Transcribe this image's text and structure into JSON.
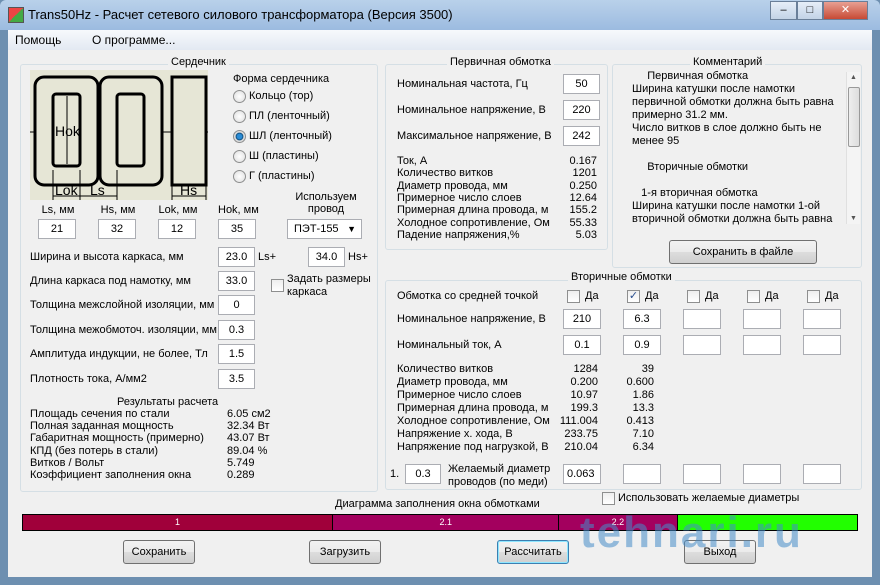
{
  "window": {
    "title": "Trans50Hz - Расчет сетевого силового трансформатора (Версия 3500)",
    "minimize": "–",
    "maximize": "□",
    "close": "✕"
  },
  "menu": [
    "Помощь",
    "О программе..."
  ],
  "core": {
    "title": "Сердечник",
    "diagram_labels": {
      "hok": "Hok",
      "lok": "Lok",
      "ls": "Ls",
      "hs": "Hs"
    },
    "shape_title": "Форма сердечника",
    "shapes": [
      {
        "label": "Кольцо  (тор)",
        "selected": false
      },
      {
        "label": "ПЛ  (ленточный)",
        "selected": false
      },
      {
        "label": "ШЛ  (ленточный)",
        "selected": true
      },
      {
        "label": "Ш  (пластины)",
        "selected": false
      },
      {
        "label": "Г (пластины)",
        "selected": false
      }
    ],
    "dims": [
      {
        "label": "Ls, мм",
        "value": "21"
      },
      {
        "label": "Hs, мм",
        "value": "32"
      },
      {
        "label": "Lok, мм",
        "value": "12"
      },
      {
        "label": "Hok, мм",
        "value": "35"
      }
    ],
    "wire_label_1": "Используем",
    "wire_label_2": "провод",
    "wire_value": "ПЭТ-155",
    "frame_label": "Ширина и высота каркаса, мм",
    "frame_w": "23.0",
    "ls_plus": "Ls+",
    "frame_h": "34.0",
    "hs_plus": "Hs+",
    "frame_len_label": "Длина каркаса под намотку, мм",
    "frame_len": "33.0",
    "set_frame_1": "Задать размеры",
    "set_frame_2": "каркаса",
    "set_frame_checked": false,
    "params": [
      {
        "label": "Толщина межслойной изоляции, мм",
        "value": "0"
      },
      {
        "label": "Толщина межобмоточ. изоляции, мм",
        "value": "0.3"
      },
      {
        "label": "Амплитуда индукции, не более, Тл",
        "value": "1.5"
      },
      {
        "label": "Плотность тока, А/мм2",
        "value": "3.5"
      }
    ],
    "results_title": "Результаты расчета",
    "results": [
      {
        "label": "Площадь сечения по стали",
        "value": "6.05 см2"
      },
      {
        "label": "Полная заданная мощность",
        "value": "32.34 Вт"
      },
      {
        "label": "Габаритная мощность (примерно)",
        "value": "43.07 Вт"
      },
      {
        "label": "КПД (без потерь в стали)",
        "value": "89.04 %"
      },
      {
        "label": "Витков / Вольт",
        "value": "5.749"
      },
      {
        "label": "Коэффициент заполнения окна",
        "value": "0.289"
      }
    ]
  },
  "primary": {
    "title": "Первичная обмотка",
    "inputs": [
      {
        "label": "Номинальная частота, Гц",
        "value": "50"
      },
      {
        "label": "Номинальное напряжение, В",
        "value": "220"
      },
      {
        "label": "Максимальное напряжение, В",
        "value": "242"
      }
    ],
    "results": [
      {
        "label": "Ток, А",
        "value": "0.167"
      },
      {
        "label": "Количество витков",
        "value": "1201"
      },
      {
        "label": "Диаметр провода, мм",
        "value": "0.250"
      },
      {
        "label": "Примерное число слоев",
        "value": "12.64"
      },
      {
        "label": "Примерная длина провода, м",
        "value": "155.2"
      },
      {
        "label": "Холодное сопротивление, Ом",
        "value": "55.33"
      },
      {
        "label": "Падение напряжения,%",
        "value": "5.03"
      }
    ]
  },
  "comment": {
    "title": "Комментарий",
    "lines": [
      "     Первичная обмотка",
      "Ширина катушки после намотки",
      "первичной обмотки должна быть равна",
      "примерно 31.2 мм.",
      "Число витков в слое должно быть не",
      "менее 95",
      "",
      "     Вторичные обмотки",
      "",
      "   1-я вторичная обмотка",
      "Ширина катушки после намотки 1-ой",
      "вторичной обмотки должна быть равна"
    ],
    "save_button": "Сохранить в файле"
  },
  "secondary": {
    "title": "Вторичные обмотки",
    "center_tap_label": "Обмотка со средней точкой",
    "yes": "Да",
    "center_tap": [
      false,
      true,
      false,
      false,
      false
    ],
    "voltage_label": "Номинальное напряжение, В",
    "voltage": [
      "210",
      "6.3",
      "",
      "",
      ""
    ],
    "current_label": "Номинальный ток, А",
    "current": [
      "0.1",
      "0.9",
      "",
      "",
      ""
    ],
    "results": [
      {
        "label": "Количество витков",
        "values": [
          "1284",
          "39"
        ]
      },
      {
        "label": "Диаметр провода, мм",
        "values": [
          "0.200",
          "0.600"
        ]
      },
      {
        "label": "Примерное число слоев",
        "values": [
          "10.97",
          "1.86"
        ]
      },
      {
        "label": "Примерная длина провода, м",
        "values": [
          "199.3",
          "13.3"
        ]
      },
      {
        "label": "Холодное сопротивление, Ом",
        "values": [
          "111.004",
          "0.413"
        ]
      },
      {
        "label": "Напряжение х. хода, В",
        "values": [
          "233.75",
          "7.10"
        ]
      },
      {
        "label": "Напряжение под нагрузкой, В",
        "values": [
          "210.04",
          "6.34"
        ]
      }
    ],
    "primary_diam_prefix": "1.",
    "primary_diam": "0.3",
    "desired_label_1": "Желаемый диаметр",
    "desired_label_2": "проводов  (по меди)",
    "desired": [
      "0.063",
      "",
      "",
      "",
      ""
    ],
    "use_desired_label": "Использовать желаемые диаметры",
    "use_desired": false
  },
  "fill": {
    "title": "Диаграмма заполнения окна обмотками",
    "segments": [
      {
        "label": "1",
        "fraction": 0.372,
        "color": "#a0003a"
      },
      {
        "label": "2.1",
        "fraction": 0.271,
        "color": "#a3005e"
      },
      {
        "label": "2.2",
        "fraction": 0.141,
        "color": "#a3005e"
      },
      {
        "label": "",
        "fraction": 0.216,
        "color": "#22ff00"
      }
    ]
  },
  "buttons": {
    "save": "Сохранить",
    "load": "Загрузить",
    "calc": "Рассчитать",
    "exit": "Выход"
  },
  "watermark": "tehnari.ru"
}
